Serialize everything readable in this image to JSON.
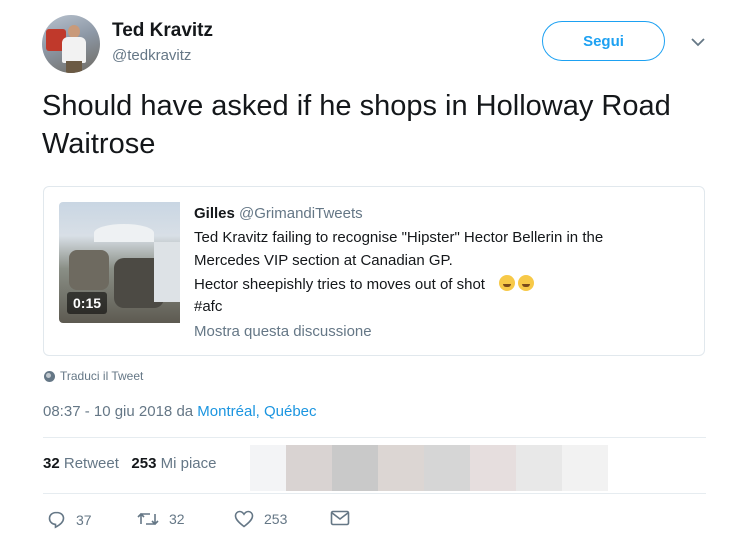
{
  "author": {
    "name": "Ted Kravitz",
    "handle": "@tedkravitz",
    "avatar_icon": "profile-photo"
  },
  "follow_button": {
    "label": "Segui",
    "color": "#1da1f2"
  },
  "menu_icon": "chevron-down-icon",
  "tweet": {
    "text": "Should have asked if he shops in Holloway Road Waitrose"
  },
  "quoted_tweet": {
    "author_name": "Gilles",
    "author_handle": "@GrimandiTweets",
    "video_duration": "0:15",
    "lines": [
      "Ted Kravitz failing to recognise \"Hipster\" Hector Bellerin in the",
      "Mercedes VIP section at Canadian GP.",
      "Hector sheepishly tries to moves out of shot",
      "#afc"
    ],
    "emoji": "face-with-tears-of-joy",
    "show_thread": "Mostra questa discussione"
  },
  "translate_label": "Traduci il Tweet",
  "timestamp": {
    "time_date": "08:37 - 10 giu 2018 da ",
    "place": "Montréal, Québec"
  },
  "stats": {
    "retweets_count": "32",
    "retweets_label": "Retweet",
    "likes_count": "253",
    "likes_label": "Mi piace",
    "liker_avatars_blurred": true
  },
  "actions": {
    "replies": "37",
    "retweets": "32",
    "likes": "253",
    "icons": [
      "reply-icon",
      "retweet-icon",
      "like-icon",
      "message-icon"
    ]
  },
  "colors": {
    "text": "#14171a",
    "secondary": "#657786",
    "link": "#1b95e0",
    "border": "#e1e8ed"
  }
}
